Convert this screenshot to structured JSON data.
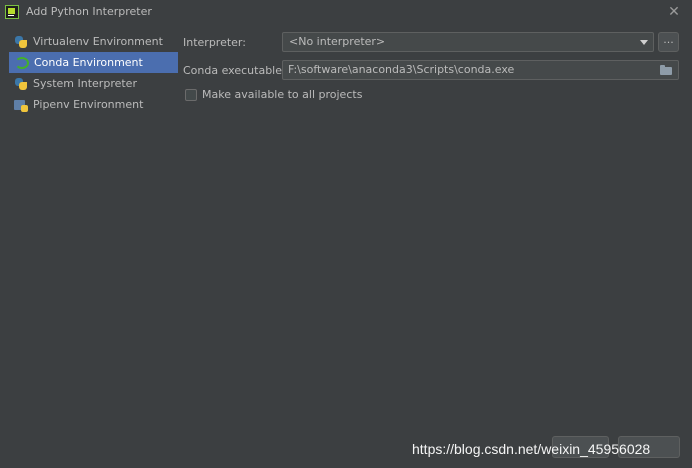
{
  "window": {
    "title": "Add Python Interpreter"
  },
  "sidebar": {
    "items": [
      {
        "label": "Virtualenv Environment",
        "icon": "python-icon"
      },
      {
        "label": "Conda Environment",
        "icon": "conda-icon",
        "selected": true
      },
      {
        "label": "System Interpreter",
        "icon": "python-icon"
      },
      {
        "label": "Pipenv Environment",
        "icon": "pipenv-icon"
      }
    ]
  },
  "form": {
    "interpreter_label": "Interpreter:",
    "interpreter_value": "<No interpreter>",
    "browse_label": "...",
    "conda_label": "Conda executable:",
    "conda_path": "F:\\software\\anaconda3\\Scripts\\conda.exe",
    "make_available_label": "Make available to all projects",
    "make_available_checked": false
  },
  "watermark": {
    "text": "https://blog.csdn.net/weixin_45956028"
  },
  "colors": {
    "background": "#3c3f41",
    "selection": "#4b6eaf",
    "field": "#45494a"
  }
}
